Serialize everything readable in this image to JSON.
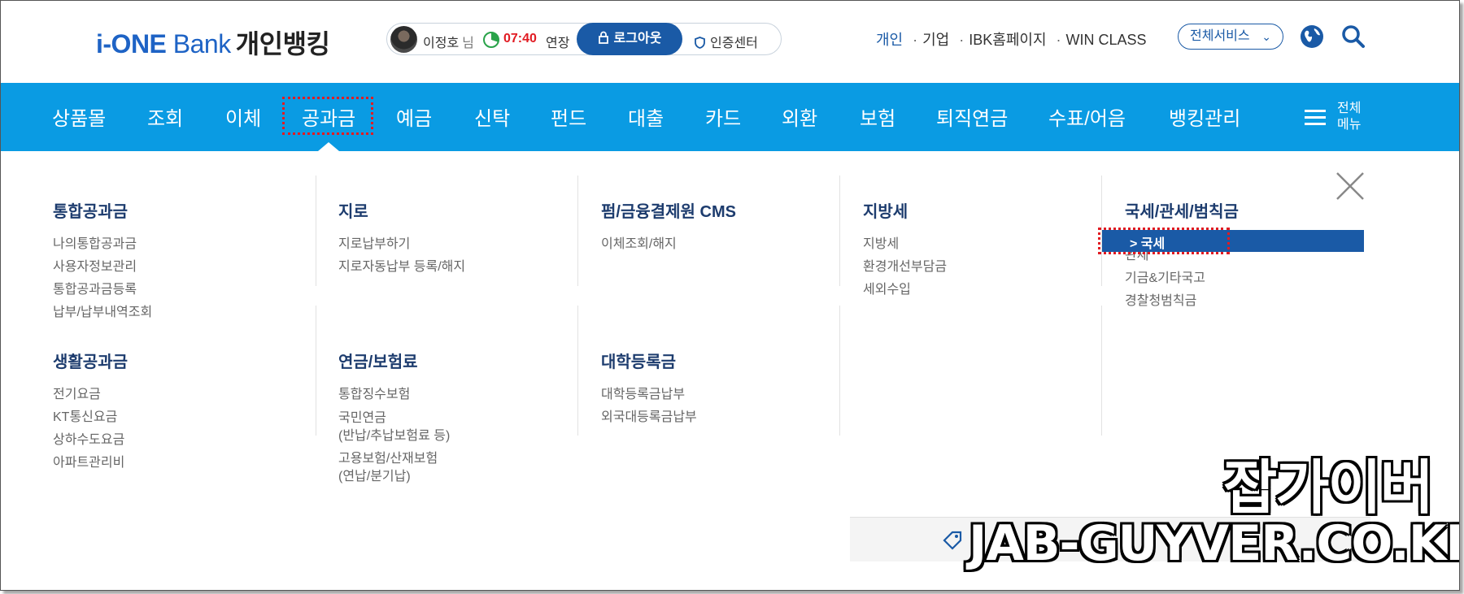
{
  "header": {
    "logo_part1": "i-ONE",
    "logo_part2": " Bank",
    "logo_part3": "개인뱅킹",
    "user_name": "이정호",
    "user_suffix": "님",
    "timer": "07:40",
    "extend_label": "연장",
    "logout_label": "로그아웃",
    "cert_label": "인증센터",
    "links": [
      "개인",
      "기업",
      "IBK홈페이지",
      "WIN CLASS"
    ],
    "all_services_label": "전체서비스",
    "accent_color": "#1a5aa6"
  },
  "nav": {
    "items": [
      "상품몰",
      "조회",
      "이체",
      "공과금",
      "예금",
      "신탁",
      "펀드",
      "대출",
      "카드",
      "외환",
      "보험",
      "퇴직연금",
      "수표/어음",
      "뱅킹관리"
    ],
    "active_index": 3,
    "all_menu_label": "전체메뉴",
    "bg_color": "#0a9be3"
  },
  "mega": {
    "groups": [
      {
        "title": "통합공과금",
        "items": [
          "나의통합공과금",
          "사용자정보관리",
          "통합공과금등록",
          "납부/납부내역조회"
        ]
      },
      {
        "title": "지로",
        "items": [
          "지로납부하기",
          "지로자동납부 등록/해지"
        ]
      },
      {
        "title": "펌/금융결제원 CMS",
        "items": [
          "이체조회/해지"
        ]
      },
      {
        "title": "지방세",
        "items": [
          "지방세",
          "환경개선부담금",
          "세외수입"
        ]
      },
      {
        "title": "국세/관세/범칙금",
        "selected_item": "> 국세",
        "items": [
          "관세",
          "기금&기타국고",
          "경찰청범칙금"
        ]
      },
      {
        "title": "생활공과금",
        "items": [
          "전기요금",
          "KT통신요금",
          "상하수도요금",
          "아파트관리비"
        ]
      },
      {
        "title": "연금/보험료",
        "items": [
          "통합징수보험",
          "국민연금",
          "(반납/추납보험료 등)",
          "고용보험/산재보험",
          "(연납/분기납)"
        ]
      },
      {
        "title": "대학등록금",
        "items": [
          "대학등록금납부",
          "외국대등록금납부"
        ]
      }
    ]
  },
  "watermark": {
    "line1": "잡가이버",
    "line2": "JAB-GUYVER.CO.KR"
  }
}
